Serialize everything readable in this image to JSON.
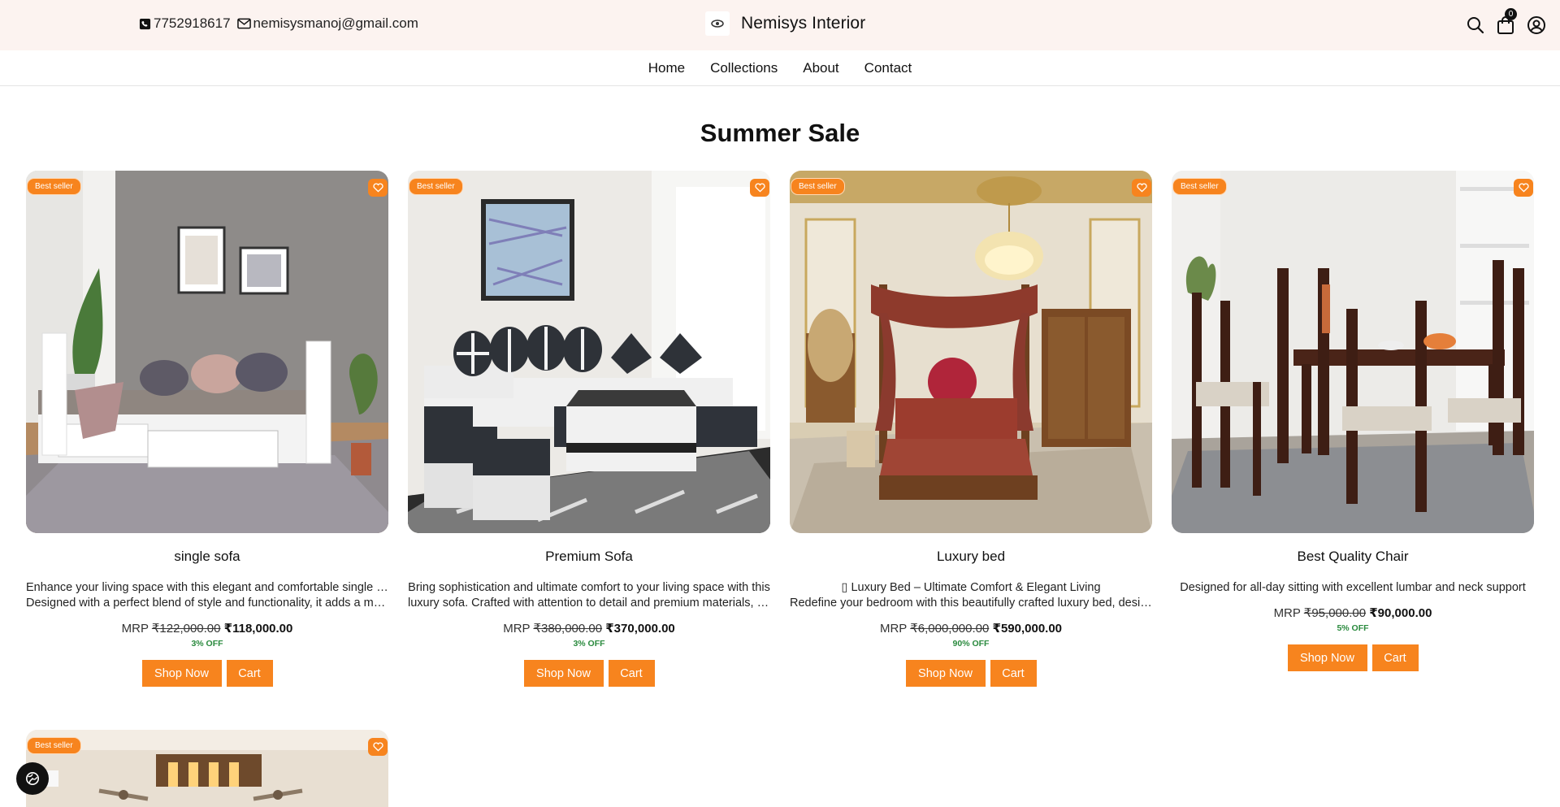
{
  "header": {
    "phone": "7752918617",
    "email": "nemisysmanoj@gmail.com",
    "brand": "Nemisys Interior",
    "cart_count": "0"
  },
  "nav": [
    {
      "label": "Home"
    },
    {
      "label": "Collections"
    },
    {
      "label": "About"
    },
    {
      "label": "Contact"
    }
  ],
  "section": {
    "title": "Summer Sale"
  },
  "products": [
    {
      "badge": "Best seller",
      "name": "single sofa",
      "desc1": "Enhance your living space with this elegant and comfortable single sofa.",
      "desc2": "Designed with a perfect blend of style and functionality, it adds a mod...",
      "mrp_label": "MRP",
      "old_price": "₹122,000.00",
      "price": "₹118,000.00",
      "discount": "3% OFF",
      "shop_label": "Shop Now",
      "cart_label": "Cart"
    },
    {
      "badge": "Best seller",
      "name": "Premium Sofa",
      "desc1": "Bring sophistication and ultimate comfort to your living space with this",
      "desc2": "luxury sofa. Crafted with attention to detail and premium materials, it...",
      "mrp_label": "MRP",
      "old_price": "₹380,000.00",
      "price": "₹370,000.00",
      "discount": "3% OFF",
      "shop_label": "Shop Now",
      "cart_label": "Cart"
    },
    {
      "badge": "Best seller",
      "name": "Luxury bed",
      "desc1": "▯ Luxury Bed – Ultimate Comfort & Elegant Living",
      "desc2": "Redefine your bedroom with this beautifully crafted luxury bed, design...",
      "mrp_label": "MRP",
      "old_price": "₹6,000,000.00",
      "price": "₹590,000.00",
      "discount": "90% OFF",
      "shop_label": "Shop Now",
      "cart_label": "Cart"
    },
    {
      "badge": "Best seller",
      "name": "Best Quality Chair",
      "desc1": "Designed for all-day sitting with excellent lumbar and neck support",
      "desc2": "",
      "mrp_label": "MRP",
      "old_price": "₹95,000.00",
      "price": "₹90,000.00",
      "discount": "5% OFF",
      "shop_label": "Shop Now",
      "cart_label": "Cart"
    },
    {
      "badge": "Best seller"
    }
  ],
  "colors": {
    "accent": "#f7841e",
    "topbar_bg": "#fcf3f0",
    "discount_green": "#2a8a3e"
  },
  "icons": [
    "phone-icon",
    "mail-icon",
    "search-icon",
    "shopping-bag-icon",
    "user-icon",
    "heart-icon",
    "globe-settings-icon"
  ]
}
